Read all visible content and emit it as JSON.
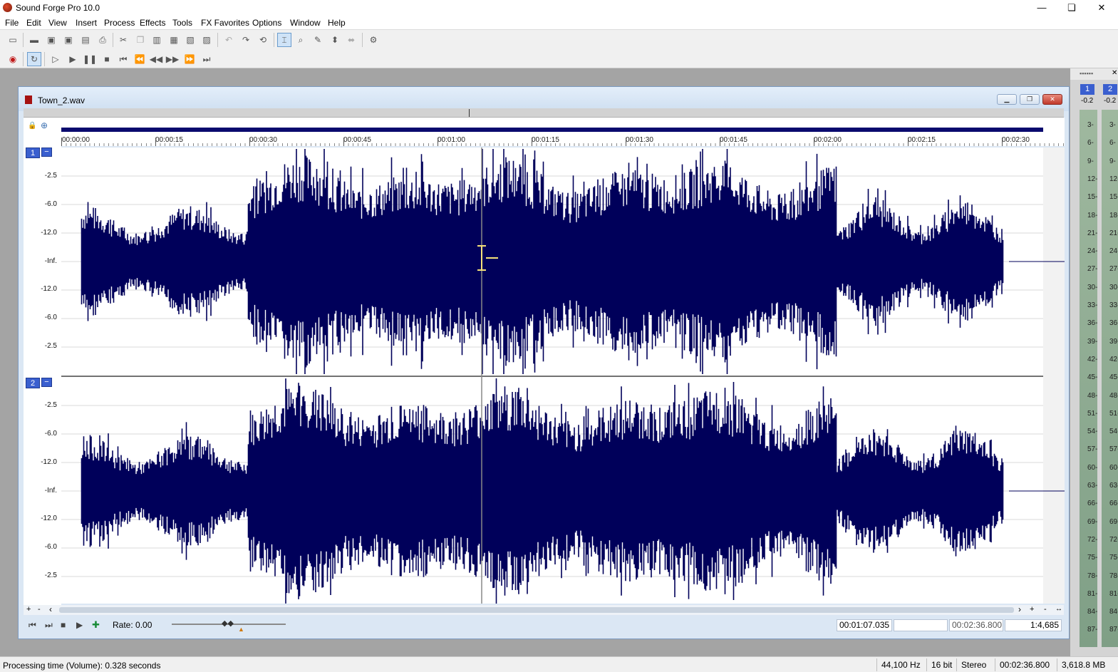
{
  "window": {
    "title": "Sound Forge Pro 10.0",
    "min": "—",
    "max": "❏",
    "close": "✕"
  },
  "menu": [
    "File",
    "Edit",
    "View",
    "Insert",
    "Process",
    "Effects",
    "Tools",
    "FX Favorites",
    "Options",
    "Window",
    "Help"
  ],
  "document": {
    "title": "Town_2.wav",
    "time_labels": [
      "00:00:00",
      "00:00:15",
      "00:00:30",
      "00:00:45",
      "00:01:00",
      "00:01:15",
      "00:01:30",
      "00:01:45",
      "00:02:00",
      "00:02:15",
      "00:02:30"
    ],
    "channel1": "1",
    "channel2": "2",
    "db_labels": [
      "-2.5",
      "-6.0",
      "-12.0",
      "-Inf.",
      "-12.0",
      "-6.0",
      "-2.5"
    ],
    "rate_label": "Rate: 0.00",
    "cursor_position": "00:01:07.035",
    "selection_length": "",
    "file_length": "00:02:36.800",
    "zoom_ratio": "1:4,685",
    "scroll_plus": "+",
    "scroll_minus": "-"
  },
  "meter": {
    "ch1": "1",
    "ch2": "2",
    "peak1": "-0.2",
    "peak2": "-0.2",
    "scale": [
      "3",
      "6",
      "9",
      "12",
      "15",
      "18",
      "21",
      "24",
      "27",
      "30",
      "33",
      "36",
      "39",
      "42",
      "45",
      "48",
      "51",
      "54",
      "57",
      "60",
      "63",
      "66",
      "69",
      "72",
      "75",
      "78",
      "81",
      "84",
      "87"
    ]
  },
  "status": {
    "message": "Processing time (Volume): 0.328 seconds",
    "sample_rate": "44,100 Hz",
    "bit_depth": "16 bit",
    "channels": "Stereo",
    "length": "00:02:36.800",
    "free_space": "3,618.8 MB"
  },
  "colors": {
    "waveform": "#00005a",
    "accent": "#3a5fcf",
    "playbar": "#0a0a6e"
  }
}
